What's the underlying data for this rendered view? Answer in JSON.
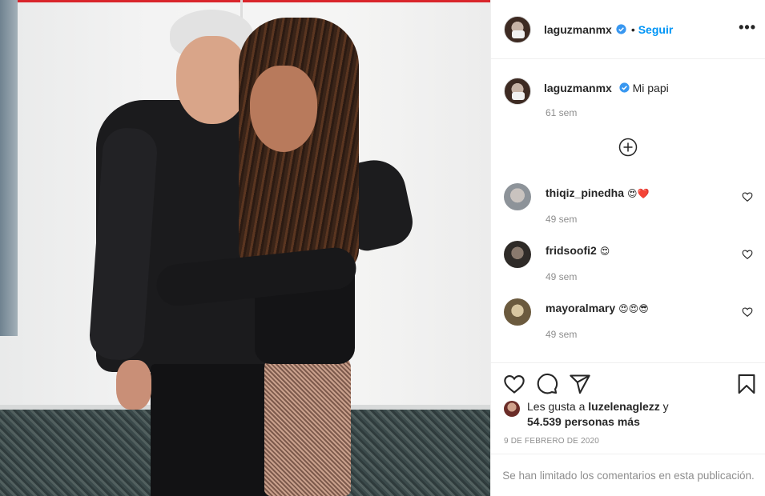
{
  "post": {
    "username": "laguzmanmx",
    "follow_label": "Seguir",
    "separator": "•",
    "more_label": "•••",
    "caption_text": "Mi papi",
    "caption_time": "61 sem",
    "date": "9 DE FEBRERO DE 2020",
    "comments_limited": "Se han limitado los comentarios en esta publicación."
  },
  "comments": [
    {
      "user": "thiqiz_pinedha",
      "emoji": "😍❤️",
      "time": "49 sem",
      "avatar_color": "#9aa0a6"
    },
    {
      "user": "fridsoofi2",
      "emoji": "😍",
      "time": "49 sem",
      "avatar_color": "#4a4540"
    },
    {
      "user": "mayoralmary",
      "emoji": "😍😍😎",
      "time": "49 sem",
      "avatar_color": "#7a6a4a"
    }
  ],
  "likes": {
    "prefix": "Les gusta a",
    "user": "luzelenaglezz",
    "conj": "y",
    "count": "54.539",
    "suffix": "personas más"
  },
  "icons": [
    "verified-icon",
    "more-options-icon",
    "load-more-icon",
    "heart-icon",
    "comment-icon",
    "share-icon",
    "save-icon"
  ],
  "colors": {
    "link": "#0095f6",
    "muted": "#8e8e8e",
    "text": "#262626"
  }
}
